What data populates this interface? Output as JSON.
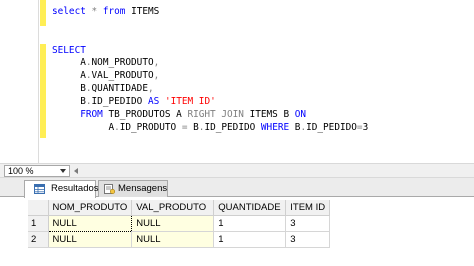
{
  "editor": {
    "lines": [
      [
        {
          "t": "select",
          "c": "kw"
        },
        {
          "t": " ",
          "c": "id"
        },
        {
          "t": "*",
          "c": "op"
        },
        {
          "t": " ",
          "c": "id"
        },
        {
          "t": "from",
          "c": "kw"
        },
        {
          "t": " ITEMS",
          "c": "id"
        }
      ],
      [],
      [],
      [
        {
          "t": "SELECT",
          "c": "kw"
        }
      ],
      [
        {
          "t": "     A",
          "c": "id"
        },
        {
          "t": ".",
          "c": "op"
        },
        {
          "t": "NOM_PRODUTO",
          "c": "id"
        },
        {
          "t": ",",
          "c": "op"
        }
      ],
      [
        {
          "t": "     A",
          "c": "id"
        },
        {
          "t": ".",
          "c": "op"
        },
        {
          "t": "VAL_PRODUTO",
          "c": "id"
        },
        {
          "t": ",",
          "c": "op"
        }
      ],
      [
        {
          "t": "     B",
          "c": "id"
        },
        {
          "t": ".",
          "c": "op"
        },
        {
          "t": "QUANTIDADE",
          "c": "id"
        },
        {
          "t": ",",
          "c": "op"
        }
      ],
      [
        {
          "t": "     B",
          "c": "id"
        },
        {
          "t": ".",
          "c": "op"
        },
        {
          "t": "ID_PEDIDO ",
          "c": "id"
        },
        {
          "t": "AS",
          "c": "kw"
        },
        {
          "t": " ",
          "c": "id"
        },
        {
          "t": "'ITEM ID'",
          "c": "str"
        }
      ],
      [
        {
          "t": "     ",
          "c": "id"
        },
        {
          "t": "FROM",
          "c": "kw"
        },
        {
          "t": " TB_PRODUTOS A ",
          "c": "id"
        },
        {
          "t": "RIGHT",
          "c": "op"
        },
        {
          "t": " ",
          "c": "id"
        },
        {
          "t": "JOIN",
          "c": "op"
        },
        {
          "t": " ITEMS B ",
          "c": "id"
        },
        {
          "t": "ON",
          "c": "kw"
        }
      ],
      [
        {
          "t": "          A",
          "c": "id"
        },
        {
          "t": ".",
          "c": "op"
        },
        {
          "t": "ID_PRODUTO ",
          "c": "id"
        },
        {
          "t": "=",
          "c": "op"
        },
        {
          "t": " B",
          "c": "id"
        },
        {
          "t": ".",
          "c": "op"
        },
        {
          "t": "ID_PEDIDO ",
          "c": "id"
        },
        {
          "t": "WHERE",
          "c": "kw"
        },
        {
          "t": " B",
          "c": "id"
        },
        {
          "t": ".",
          "c": "op"
        },
        {
          "t": "ID_PEDIDO",
          "c": "id"
        },
        {
          "t": "=",
          "c": "op"
        },
        {
          "t": "3",
          "c": "id"
        }
      ]
    ]
  },
  "zoom": {
    "value": "100 %"
  },
  "results_tabs": {
    "results_label": "Resultados",
    "messages_label": "Mensagens"
  },
  "grid": {
    "columns": [
      "NOM_PRODUTO",
      "VAL_PRODUTO",
      "QUANTIDADE",
      "ITEM ID"
    ],
    "rows": [
      {
        "num": "1",
        "cells": [
          "NULL",
          "NULL",
          "1",
          "3"
        ]
      },
      {
        "num": "2",
        "cells": [
          "NULL",
          "NULL",
          "1",
          "3"
        ]
      }
    ]
  },
  "icons": {
    "results_tab": "grid-icon",
    "messages_tab": "messages-icon"
  }
}
